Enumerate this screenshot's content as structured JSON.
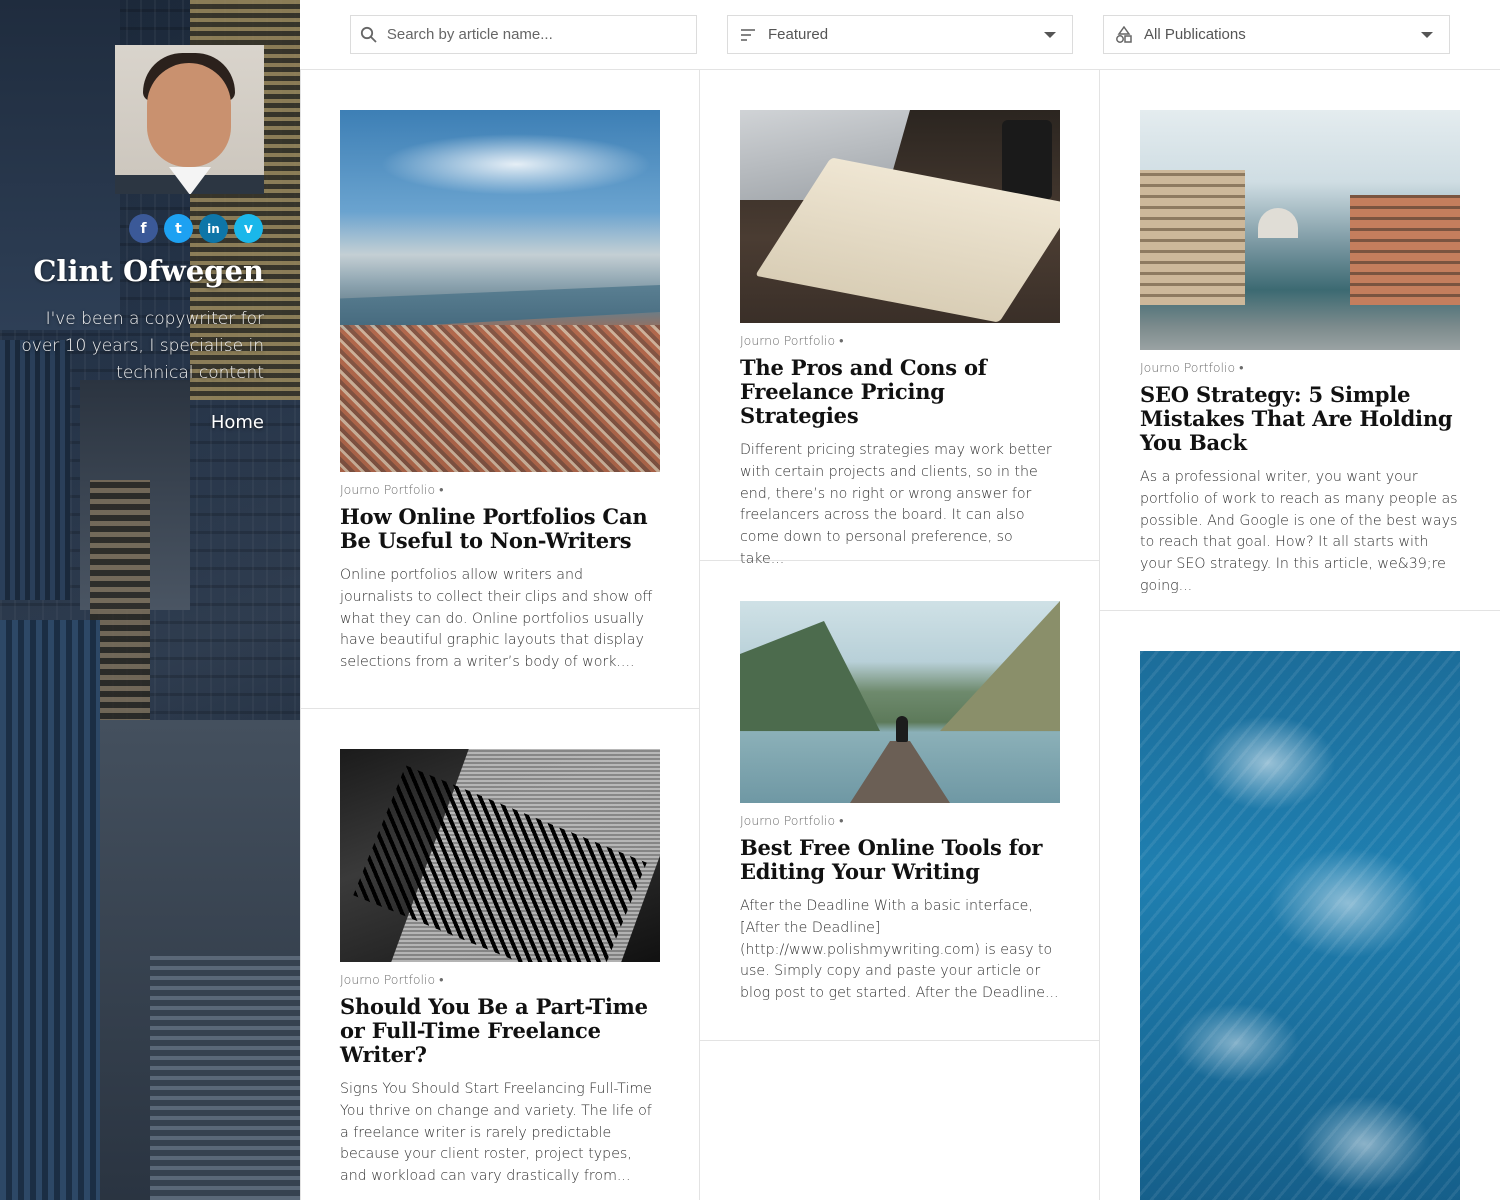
{
  "profile": {
    "name": "Clint Ofwegen",
    "bio": "I've been a copywriter for over 10 years, I specialise in technical content",
    "nav": {
      "home": "Home"
    },
    "social": [
      {
        "icon": "facebook-icon",
        "glyph": "f",
        "color": "#3b5998"
      },
      {
        "icon": "twitter-icon",
        "glyph": "t",
        "color": "#1da1f2"
      },
      {
        "icon": "linkedin-icon",
        "glyph": "in",
        "color": "#0e76a8"
      },
      {
        "icon": "vimeo-icon",
        "glyph": "v",
        "color": "#1ab7ea"
      }
    ]
  },
  "toolbar": {
    "search": {
      "placeholder": "Search by article name...",
      "value": "",
      "icon": "search-icon"
    },
    "sort": {
      "selected": "Featured",
      "icon": "sort-icon"
    },
    "publication": {
      "selected": "All Publications",
      "icon": "shapes-icon"
    }
  },
  "articles": [
    {
      "publication": "Journo Portfolio •",
      "title": "How Online Portfolios Can Be Useful to Non-Writers",
      "excerpt": "Online portfolios allow writers and journalists to collect their clips and show off what they can do. Online portfolios usually have beautiful graphic layouts that display selections from a writer’s body of work....",
      "image": "istanbul-aerial-city"
    },
    {
      "publication": "Journo Portfolio •",
      "title": "The Pros and Cons of Freelance Pricing Strategies",
      "excerpt": "Different pricing strategies may work better with certain projects and clients, so in the end, there’s no right or wrong answer for freelancers across the board. It can also come down to personal preference, so take...",
      "image": "laptop-notebook-desk"
    },
    {
      "publication": "Journo Portfolio •",
      "title": "SEO Strategy: 5 Simple Mistakes That Are Holding You Back",
      "excerpt": "As a professional writer, you want your portfolio of work to reach as many people as possible. And Google is one of the best ways to reach that goal. How? It all starts with your SEO strategy. In this article, we&39;re going...",
      "image": "venice-canal"
    },
    {
      "publication": "Journo Portfolio •",
      "title": "Best Free Online Tools for Editing Your Writing",
      "excerpt": "After the Deadline With a basic interface, [After the Deadline](http://www.polishmywriting.com) is easy to use. Simply copy and paste your article or blog post to get started. After the Deadline...",
      "image": "fjord-pier-mountains"
    },
    {
      "publication": "Journo Portfolio •",
      "title": "Should You Be a Part-Time or Full-Time Freelance Writer?",
      "excerpt": "Signs You Should Start Freelancing Full-Time You thrive on change and variety. The life of a freelance writer is rarely predictable because your client roster, project types, and workload can vary drastically from...",
      "image": "newspaper-rack-bw"
    },
    {
      "image": "ocean-waves-aerial"
    }
  ]
}
